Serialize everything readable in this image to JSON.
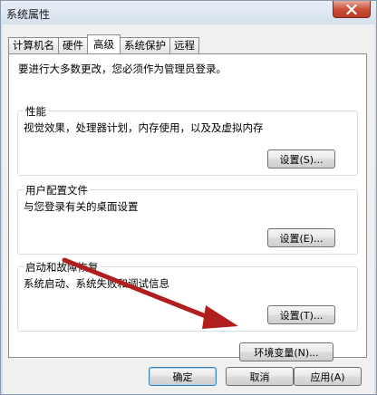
{
  "window": {
    "title": "系统属性"
  },
  "tabs": [
    {
      "label": "计算机名"
    },
    {
      "label": "硬件"
    },
    {
      "label": "高级",
      "active": true
    },
    {
      "label": "系统保护"
    },
    {
      "label": "远程"
    }
  ],
  "advanced": {
    "intro": "要进行大多数更改，您必须作为管理员登录。",
    "performance": {
      "title": "性能",
      "description": "视觉效果，处理器计划，内存使用，以及及虚拟内存",
      "button": "设置(S)..."
    },
    "user_profiles": {
      "title": "用户配置文件",
      "description": "与您登录有关的桌面设置",
      "button": "设置(E)..."
    },
    "startup_recovery": {
      "title": "启动和故障恢复",
      "description": "系统启动、系统失败和调试信息",
      "button": "设置(T)..."
    },
    "env_button": "环境变量(N)..."
  },
  "footer": {
    "ok": "确定",
    "cancel": "取消",
    "apply": "应用(A)"
  },
  "annotation": {
    "arrow_color": "#b01e1e"
  },
  "icons": {
    "close": "close-icon"
  }
}
